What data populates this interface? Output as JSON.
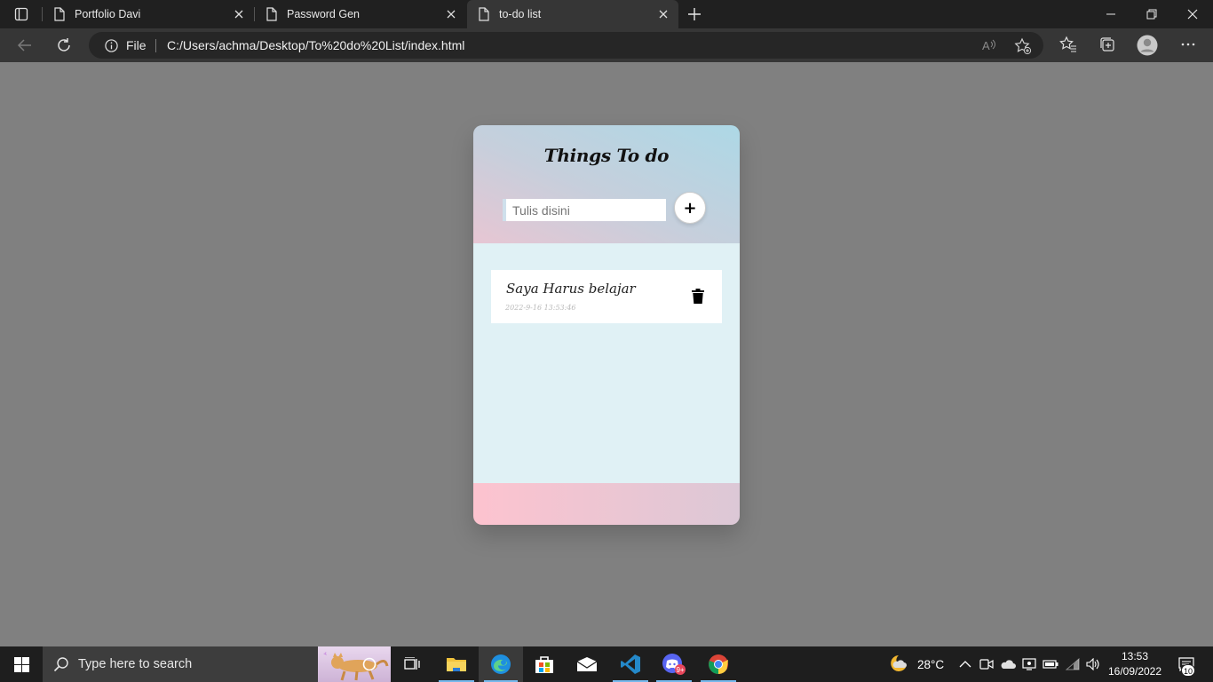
{
  "browser": {
    "tabs": [
      {
        "title": "Portfolio Davi"
      },
      {
        "title": "Password Gen"
      },
      {
        "title": "to-do list",
        "active": true
      }
    ],
    "address": {
      "scheme_label": "File",
      "url": "C:/Users/achma/Desktop/To%20do%20List/index.html"
    }
  },
  "page": {
    "title": "Things To do",
    "input": {
      "placeholder": "Tulis disini",
      "value": ""
    },
    "add_button_label": "+",
    "todos": [
      {
        "text": "Saya Harus belajar",
        "timestamp": "2022-9-16 13:53:46"
      }
    ],
    "colors": {
      "header_gradient": [
        "#e7c6d3",
        "#add8e6"
      ],
      "body": "#e0f1f5",
      "footer_gradient": [
        "#fdc3cf",
        "#dcc8d6"
      ],
      "page_background": "#808080"
    }
  },
  "taskbar": {
    "search_placeholder": "Type here to search",
    "pinned_apps": [
      "cortana",
      "task-view",
      "file-explorer",
      "edge",
      "microsoft-store",
      "mail",
      "vs-code",
      "discord",
      "chrome"
    ],
    "weather": {
      "temperature": "28°C",
      "icon": "moon-cloud-icon"
    },
    "clock": {
      "time": "13:53",
      "date": "16/09/2022"
    },
    "notifications_count": "10"
  }
}
